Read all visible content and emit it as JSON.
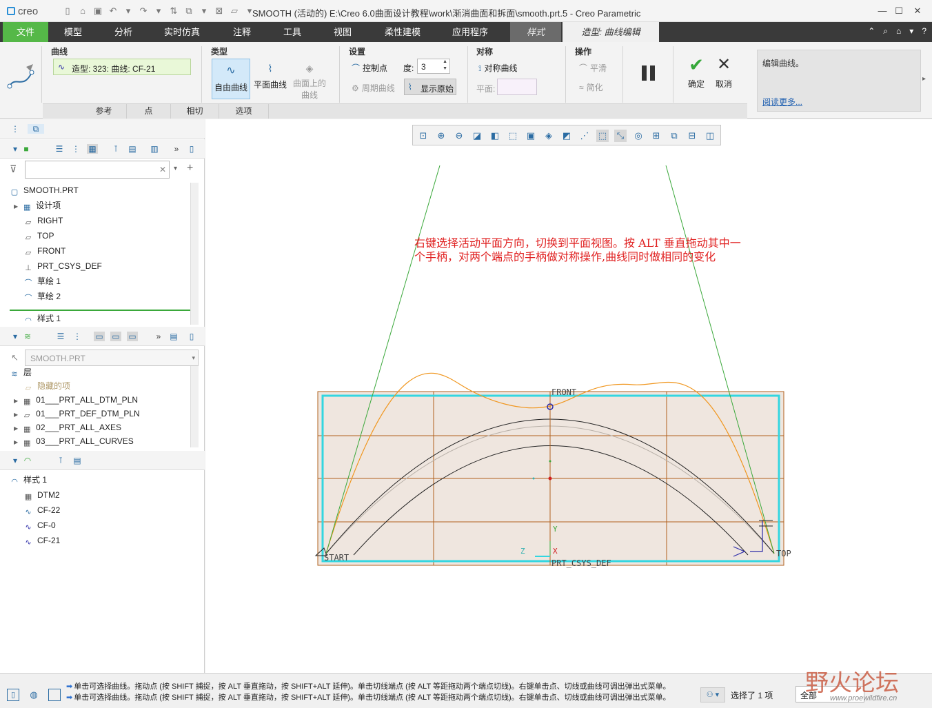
{
  "app": {
    "logo": "creo",
    "window_title": "SMOOTH (活动的) E:\\Creo 6.0曲面设计教程\\work\\渐消曲面和拆面\\smooth.prt.5 - Creo Parametric"
  },
  "menu": {
    "tabs": [
      "文件",
      "模型",
      "分析",
      "实时仿真",
      "注释",
      "工具",
      "视图",
      "柔性建模",
      "应用程序",
      "样式",
      "造型: 曲线编辑"
    ]
  },
  "ribbon": {
    "curve_group_title": "曲线",
    "curve_name": "造型: 323: 曲线: CF-21",
    "type_group_title": "类型",
    "type_free": "自由曲线",
    "type_planar": "平面曲线",
    "type_cos_line1": "曲面上的",
    "type_cos_line2": "曲线",
    "settings_group_title": "设置",
    "control_points": "控制点",
    "degree_label": "度:",
    "degree_value": "3",
    "periodic_curve": "周期曲线",
    "show_original": "显示原始",
    "symmetry_group_title": "对称",
    "symmetric_curve": "对称曲线",
    "plane_label": "平面:",
    "ops_group_title": "操作",
    "smooth": "平滑",
    "simplify": "简化",
    "ok": "确定",
    "cancel": "取消",
    "help_text": "编辑曲线。",
    "help_link": "阅读更多...",
    "subtabs": [
      "参考",
      "点",
      "相切",
      "选项"
    ]
  },
  "model_tree": {
    "search_placeholder": "",
    "root": "SMOOTH.PRT",
    "items": [
      "设计项",
      "RIGHT",
      "TOP",
      "FRONT",
      "PRT_CSYS_DEF",
      "草绘 1",
      "草绘 2",
      "样式 1"
    ]
  },
  "layer_tree": {
    "selector": "SMOOTH.PRT",
    "root": "层",
    "items": [
      "隐藏的项",
      "01___PRT_ALL_DTM_PLN",
      "01___PRT_DEF_DTM_PLN",
      "02___PRT_ALL_AXES",
      "03___PRT_ALL_CURVES"
    ]
  },
  "style_tree": {
    "root": "样式 1",
    "items": [
      "DTM2",
      "CF-22",
      "CF-0",
      "CF-21"
    ]
  },
  "canvas": {
    "annotation_line1": "右键选择活动平面方向，切换到平面视图。按 ALT 垂直拖动其中一",
    "annotation_line2": "个手柄，对两个端点的手柄做对称操作,曲线同时做相同的变化",
    "labels": {
      "front": "FRONT",
      "start": "START",
      "top": "TOP",
      "csys": "PRT_CSYS_DEF",
      "x": "X",
      "y": "Y",
      "z": "Z"
    }
  },
  "status": {
    "msg1": "单击可选择曲线。拖动点 (按 SHIFT 捕捉，按 ALT 垂直拖动，按 SHIFT+ALT 延伸)。单击切线端点 (按 ALT 等距拖动两个端点切线)。右键单击点、切线或曲线可调出弹出式菜单。",
    "msg2": "单击可选择曲线。拖动点 (按 SHIFT 捕捉，按 ALT 垂直拖动，按 SHIFT+ALT 延伸)。单击切线端点 (按 ALT 等距拖动两个端点切线)。右键单击点、切线或曲线可调出弹出式菜单。",
    "selected": "选择了 1 项",
    "filter": "全部",
    "watermark_cn": "野火论坛",
    "watermark_url": "www.proewildfire.cn"
  },
  "colors": {
    "file_tab": "#55b848",
    "menubar": "#3a3a3a",
    "annotation": "#e02020",
    "plane_border": "#33d6e0",
    "curve_orange": "#f0961e",
    "handle_green": "#3aa83a",
    "grid_brown": "#b0601c",
    "accent_blue": "#2a6fd0"
  }
}
